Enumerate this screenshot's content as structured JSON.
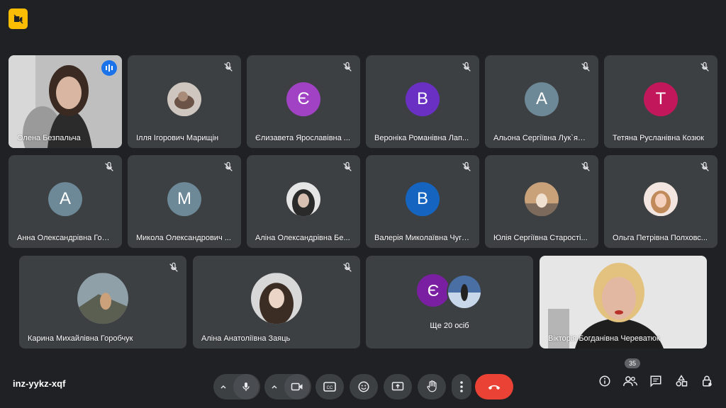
{
  "meeting": {
    "code": "inz-yykz-xqf",
    "participants_count": "35"
  },
  "colors": {
    "accent": "#8ab4f8",
    "speaking": "#1a73e8",
    "end_call": "#ea4335",
    "tile_bg": "#3c4043",
    "page_bg": "#202124"
  },
  "tiles": [
    {
      "name": "Олена Безпальча",
      "type": "video",
      "speaking": true
    },
    {
      "name": "Ілля Ігорович Марищін",
      "type": "photo"
    },
    {
      "name": "Єлизавета Ярославівна ...",
      "initial": "Є",
      "color": "#a142c5"
    },
    {
      "name": "Вероніка Романівна Лап...",
      "initial": "В",
      "color": "#6930c3"
    },
    {
      "name": "Альона Сергіївна Лук`ян...",
      "initial": "А",
      "color": "#6d8896"
    },
    {
      "name": "Тетяна Русланівна Козюк",
      "initial": "Т",
      "color": "#c2185b"
    },
    {
      "name": "Анна Олександрівна Гол...",
      "initial": "А",
      "color": "#6d8896"
    },
    {
      "name": "Микола Олександрович ...",
      "initial": "М",
      "color": "#6d8896"
    },
    {
      "name": "Аліна Олександрівна Бе...",
      "type": "photo"
    },
    {
      "name": "Валерія Миколаївна Чугай",
      "initial": "В",
      "color": "#1565c0"
    },
    {
      "name": "Юлія Сергіївна Старості...",
      "type": "photo"
    },
    {
      "name": "Ольга Петрівна Полховс...",
      "type": "photo"
    },
    {
      "name": "Карина Михайлівна Горобчук",
      "type": "photo"
    },
    {
      "name": "Аліна Анатоліївна Заяць",
      "type": "photo"
    },
    {
      "name": "Ще 20 осіб",
      "initial": "Є",
      "color": "#7b1fa2"
    },
    {
      "name": "Вікторія Богданівна Череватюк",
      "type": "video"
    }
  ],
  "icons": [
    "mic-off-icon",
    "mic-icon",
    "camera-icon",
    "captions-icon",
    "emoji-icon",
    "present-icon",
    "raise-hand-icon",
    "more-options-icon",
    "end-call-icon",
    "info-icon",
    "people-icon",
    "chat-icon",
    "activities-icon",
    "host-controls-icon"
  ]
}
